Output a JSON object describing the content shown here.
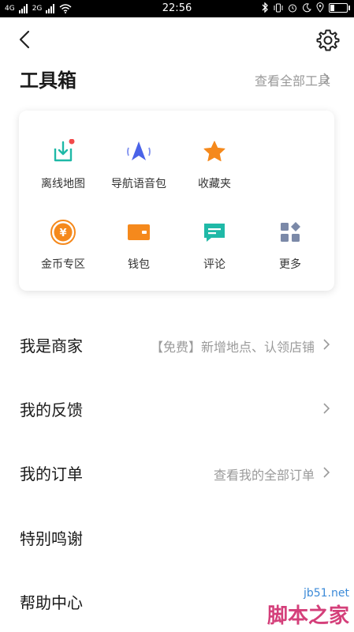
{
  "status_bar": {
    "signal_left": "4G",
    "signal_right": "2G",
    "time": "22:56",
    "battery_level": 0.3
  },
  "header": {
    "back_icon": "back-chevron",
    "settings_icon": "gear"
  },
  "toolbox": {
    "title": "工具箱",
    "see_all": "查看全部工具",
    "items": [
      {
        "label": "离线地图",
        "icon": "download-map",
        "color": "#1fb9a7",
        "badge": true
      },
      {
        "label": "导航语音包",
        "icon": "navigation-arrow",
        "color": "#4a63e8"
      },
      {
        "label": "收藏夹",
        "icon": "star",
        "color": "#f5891c"
      },
      {
        "label": "金币专区",
        "icon": "coin",
        "color": "#f5891c"
      },
      {
        "label": "钱包",
        "icon": "wallet",
        "color": "#f5891c"
      },
      {
        "label": "评论",
        "icon": "comment",
        "color": "#1fb9a7"
      },
      {
        "label": "更多",
        "icon": "more-grid",
        "color": "#7b89a8"
      }
    ]
  },
  "menu": [
    {
      "title": "我是商家",
      "sub": "【免费】新增地点、认领店铺",
      "chevron": true
    },
    {
      "title": "我的反馈",
      "sub": "",
      "chevron": true
    },
    {
      "title": "我的订单",
      "sub": "查看我的全部订单",
      "chevron": true
    },
    {
      "title": "特别鸣谢",
      "sub": "",
      "chevron": false
    },
    {
      "title": "帮助中心",
      "sub": "",
      "chevron": false
    }
  ],
  "watermark": {
    "url": "jb51.net",
    "name": "脚本之家"
  }
}
